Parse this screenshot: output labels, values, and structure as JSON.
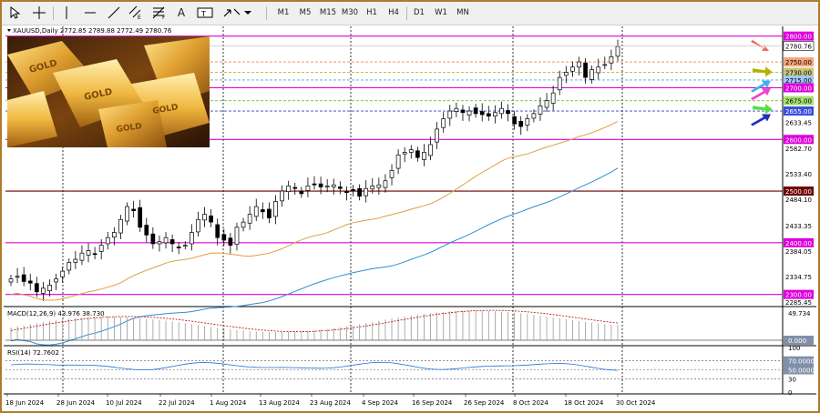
{
  "toolbar": {
    "tools": [
      {
        "name": "cursor-icon"
      },
      {
        "name": "crosshair-icon"
      },
      {
        "name": "vertical-line-icon"
      },
      {
        "name": "horizontal-line-icon"
      },
      {
        "name": "trendline-icon"
      },
      {
        "name": "equidistant-channel-icon"
      },
      {
        "name": "fibonacci-icon"
      },
      {
        "name": "text-icon",
        "label": "A"
      },
      {
        "name": "text-label-icon"
      },
      {
        "name": "arrows-icon"
      }
    ],
    "timeframes": [
      "M1",
      "M5",
      "M15",
      "M30",
      "H1",
      "H4",
      "D1",
      "W1",
      "MN"
    ]
  },
  "chart": {
    "symbol_line": "XAUUSD,Daily  2772.85 2789.88 2772.49 2780.76",
    "price_labels": [
      {
        "value": "2800.00",
        "price": 2800,
        "bg": "#dd00dd",
        "fg": "#ffffff"
      },
      {
        "value": "2780.76",
        "price": 2780.76,
        "bg": "#ffffff",
        "fg": "#000000"
      },
      {
        "value": "2750.00",
        "price": 2750,
        "bg": "#f4a37a",
        "fg": "#000000"
      },
      {
        "value": "2730.00",
        "price": 2730,
        "bg": "#c9c47a",
        "fg": "#000000"
      },
      {
        "value": "2715.00",
        "price": 2715,
        "bg": "#9ec9f0",
        "fg": "#000000"
      },
      {
        "value": "2700.00",
        "price": 2700,
        "bg": "#dd00dd",
        "fg": "#ffffff"
      },
      {
        "value": "2675.00",
        "price": 2675,
        "bg": "#a6e070",
        "fg": "#000000"
      },
      {
        "value": "2655.00",
        "price": 2655,
        "bg": "#3b4fd8",
        "fg": "#ffffff"
      },
      {
        "value": "2633.45",
        "price": 2633.45,
        "bg": "",
        "fg": "#000000"
      },
      {
        "value": "2600.00",
        "price": 2600,
        "bg": "#dd00dd",
        "fg": "#ffffff"
      },
      {
        "value": "2582.70",
        "price": 2582.7,
        "bg": "",
        "fg": "#000000"
      },
      {
        "value": "2533.40",
        "price": 2533.4,
        "bg": "",
        "fg": "#000000"
      },
      {
        "value": "2500.00",
        "price": 2500,
        "bg": "#6b0000",
        "fg": "#ffffff"
      },
      {
        "value": "2484.10",
        "price": 2484.1,
        "bg": "",
        "fg": "#000000"
      },
      {
        "value": "2433.35",
        "price": 2433.35,
        "bg": "",
        "fg": "#000000"
      },
      {
        "value": "2400.00",
        "price": 2400,
        "bg": "#dd00dd",
        "fg": "#ffffff"
      },
      {
        "value": "2384.05",
        "price": 2384.05,
        "bg": "",
        "fg": "#000000"
      },
      {
        "value": "2334.75",
        "price": 2334.75,
        "bg": "",
        "fg": "#000000"
      },
      {
        "value": "2300.00",
        "price": 2300,
        "bg": "#dd00dd",
        "fg": "#ffffff"
      },
      {
        "value": "2285.45",
        "price": 2285.45,
        "bg": "",
        "fg": "#000000"
      }
    ],
    "levels": [
      {
        "price": 2800,
        "color": "#dd00dd",
        "style": "solid"
      },
      {
        "price": 2750,
        "color": "#f08050",
        "style": "dash"
      },
      {
        "price": 2730,
        "color": "#b8b040",
        "style": "dash"
      },
      {
        "price": 2715,
        "color": "#5aa0e0",
        "style": "dash"
      },
      {
        "price": 2700,
        "color": "#dd00dd",
        "style": "solid"
      },
      {
        "price": 2675,
        "color": "#70c030",
        "style": "dash"
      },
      {
        "price": 2655,
        "color": "#3040d0",
        "style": "dash"
      },
      {
        "price": 2600,
        "color": "#dd00dd",
        "style": "solid"
      },
      {
        "price": 2500,
        "color": "#6b0000",
        "style": "solid"
      },
      {
        "price": 2400,
        "color": "#dd00dd",
        "style": "solid"
      },
      {
        "price": 2300,
        "color": "#dd00dd",
        "style": "solid"
      }
    ],
    "arrows": [
      {
        "name": "salmon-arrow-icon",
        "color": "#f0605a",
        "dir": "down-right"
      },
      {
        "name": "olive-arrow-icon",
        "color": "#b8b000",
        "dir": "right"
      },
      {
        "name": "blue-arrow-icon",
        "color": "#40b0f0",
        "dir": "up-right"
      },
      {
        "name": "pink-arrow-icon",
        "color": "#f040d0",
        "dir": "up-right"
      },
      {
        "name": "green-arrow-icon",
        "color": "#50e040",
        "dir": "right"
      },
      {
        "name": "navy-arrow-icon",
        "color": "#2030c0",
        "dir": "up-right"
      }
    ],
    "macd_label": "MACD(12,26,9) 43.976 38.730",
    "macd_axis": [
      "49.734",
      "0.000"
    ],
    "rsi_label": "RSI(14) 72.7602",
    "rsi_axis": [
      {
        "value": "100",
        "bg": "",
        "fg": "#000000"
      },
      {
        "value": "70.0000",
        "bg": "#8090a8",
        "fg": "#ffffff"
      },
      {
        "value": "50.0000",
        "bg": "#8090a8",
        "fg": "#ffffff"
      },
      {
        "value": "30",
        "bg": "",
        "fg": "#000000"
      },
      {
        "value": "0",
        "bg": "",
        "fg": "#000000"
      }
    ],
    "date_labels": [
      "18 Jun 2024",
      "28 Jun 2024",
      "10 Jul 2024",
      "22 Jul 2024",
      "1 Aug 2024",
      "13 Aug 2024",
      "23 Aug 2024",
      "4 Sep 2024",
      "16 Sep 2024",
      "26 Sep 2024",
      "8 Oct 2024",
      "18 Oct 2024",
      "30 Oct 2024"
    ],
    "colors": {
      "ma_slow": "#2f8fd0",
      "ma_fast": "#e0a040",
      "candle": "#000000"
    }
  },
  "image": {
    "gold_bar_text": [
      "GOLD",
      "GOLD",
      "GOLD",
      "GOLD"
    ]
  }
}
